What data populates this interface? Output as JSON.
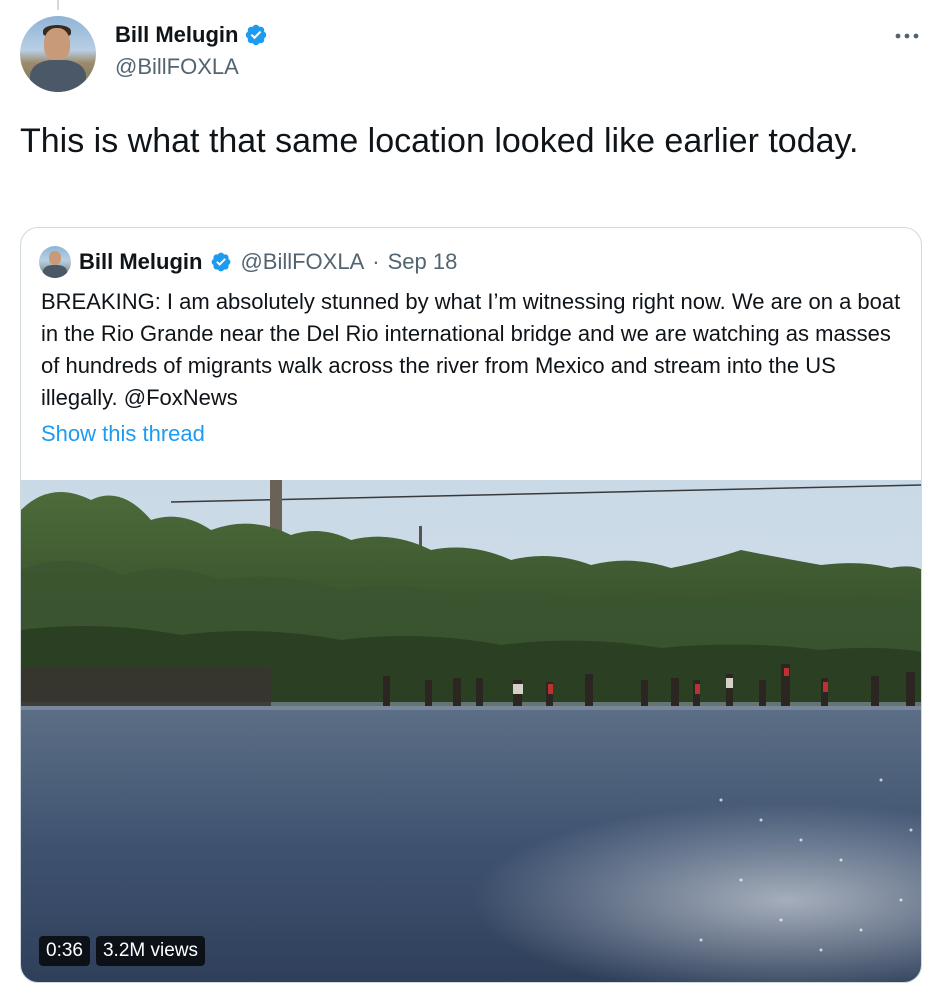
{
  "author": {
    "name": "Bill Melugin",
    "handle": "@BillFOXLA",
    "verified": true
  },
  "tweet": {
    "text": "This is what that same location looked like earlier today."
  },
  "more_icon": "more-horizontal-icon",
  "quoted_tweet": {
    "name": "Bill Melugin",
    "handle": "@BillFOXLA",
    "separator": "·",
    "date": "Sep 18",
    "text": "BREAKING: I am absolutely stunned by what I’m witnessing right now. We are on a boat in the Rio Grande near the Del Rio international bridge and we are watching as masses of hundreds of migrants walk across the river from Mexico and stream into the US illegally.  @FoxNews",
    "show_thread_label": "Show this thread",
    "video": {
      "duration": "0:36",
      "views": "3.2M views"
    }
  },
  "colors": {
    "link": "#1d9bf0",
    "verified": "#1d9bf0",
    "secondary_text": "#536471",
    "border": "#cfd9de"
  }
}
